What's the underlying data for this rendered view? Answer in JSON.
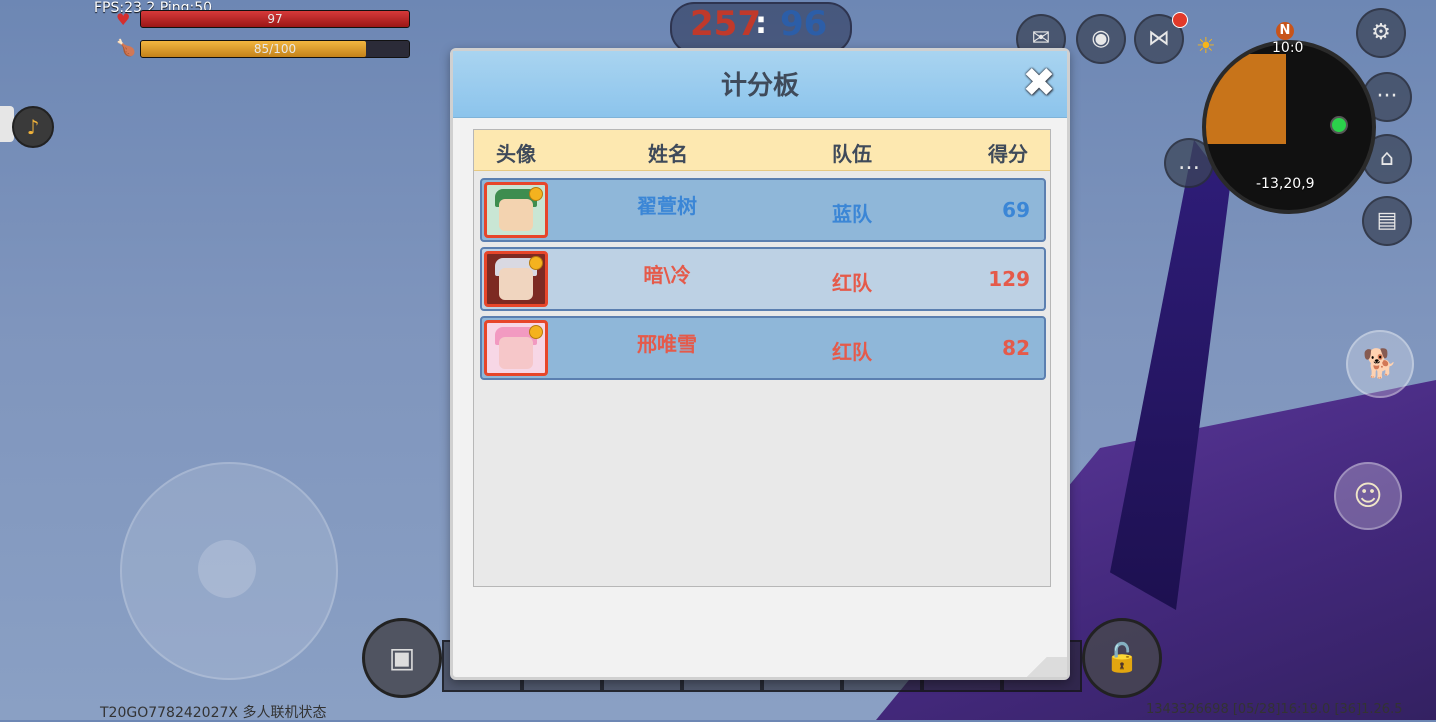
{
  "hud": {
    "fps_ping": "FPS:23.2  Ping:50",
    "health": "97",
    "hunger": "85/100",
    "hunger_fraction": 0.85,
    "score_red": "257",
    "score_sep": ":",
    "score_blue": "96",
    "map_time": "10:0",
    "map_coord": "-13,20,9",
    "compass_label": "N",
    "build_info": "T20GO778242027X 多人联机状态",
    "status_info": "1343326698   [05/28]16:19.0   [36]1.26.5"
  },
  "icons": {
    "health": "heart-icon",
    "hunger": "drumstick-icon",
    "music": "music-note-icon",
    "mail": "mail-icon",
    "camera": "camera-icon",
    "share": "share-icon",
    "settings": "gear-icon",
    "more": "more-icon",
    "chat": "chat-icon",
    "home": "home-icon",
    "notes": "notebook-icon",
    "pet": "dog-icon",
    "action": "person-icon",
    "backpack": "backpack-icon",
    "lock": "lock-icon",
    "close": "close-icon"
  },
  "scoreboard": {
    "title": "计分板",
    "columns": {
      "avatar": "头像",
      "name": "姓名",
      "team": "队伍",
      "score": "得分"
    },
    "rows": [
      {
        "name": "翟萱树",
        "team": "蓝队",
        "score": "69",
        "team_color": "blue"
      },
      {
        "name": "暗\\冷",
        "team": "红队",
        "score": "129",
        "team_color": "red"
      },
      {
        "name": "邢唯雪",
        "team": "红队",
        "score": "82",
        "team_color": "red"
      }
    ]
  },
  "colors": {
    "blue_team": "#3b86d6",
    "red_team": "#e55a4a",
    "header_bar": "#fde8b0",
    "dialog_header": "#a9d4f0"
  }
}
